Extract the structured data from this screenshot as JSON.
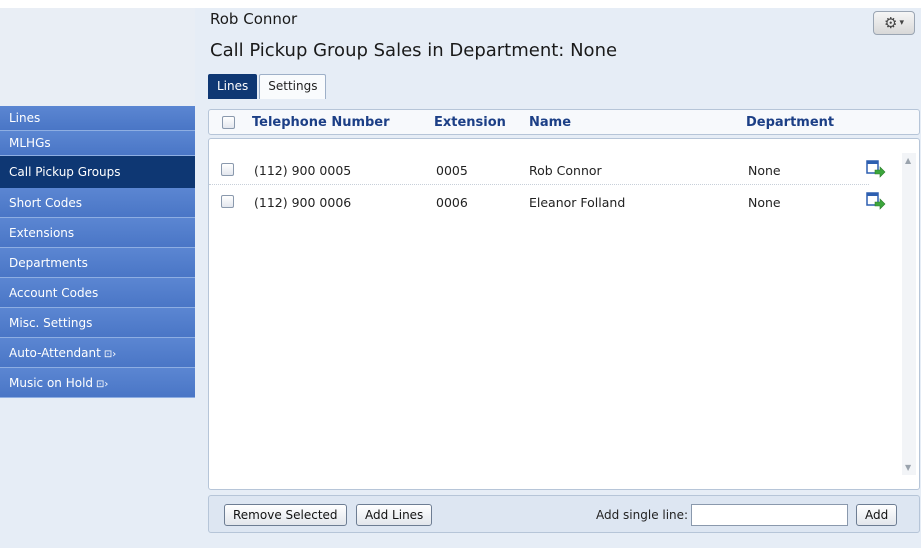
{
  "header": {
    "user_name": "Rob Connor",
    "page_title": "Call Pickup Group Sales in Department: None",
    "gear_icon": "gear-icon"
  },
  "tabs": [
    {
      "label": "Lines",
      "active": true
    },
    {
      "label": "Settings",
      "active": false
    }
  ],
  "sidebar": {
    "items": [
      {
        "label": "Lines",
        "active": false,
        "external": false
      },
      {
        "label": "MLHGs",
        "active": false,
        "external": false
      },
      {
        "label": "Call Pickup Groups",
        "active": true,
        "external": false
      },
      {
        "label": "Short Codes",
        "active": false,
        "external": false
      },
      {
        "label": "Extensions",
        "active": false,
        "external": false
      },
      {
        "label": "Departments",
        "active": false,
        "external": false
      },
      {
        "label": "Account Codes",
        "active": false,
        "external": false
      },
      {
        "label": "Misc. Settings",
        "active": false,
        "external": false
      },
      {
        "label": "Auto-Attendant",
        "active": false,
        "external": true
      },
      {
        "label": "Music on Hold",
        "active": false,
        "external": true
      }
    ],
    "external_glyph": "⊡›"
  },
  "table": {
    "columns": [
      "Telephone Number",
      "Extension",
      "Name",
      "Department"
    ],
    "rows": [
      {
        "telephone": "(112) 900 0005",
        "extension": "0005",
        "name": "Rob Connor",
        "department": "None"
      },
      {
        "telephone": "(112) 900 0006",
        "extension": "0006",
        "name": "Eleanor Folland",
        "department": "None"
      }
    ]
  },
  "footer": {
    "remove_label": "Remove Selected",
    "add_lines_label": "Add Lines",
    "single_line_label": "Add single line:",
    "single_line_value": "",
    "add_label": "Add"
  },
  "colors": {
    "sidebar": "#4a76c6",
    "sidebar_active": "#0e3773",
    "header_text": "#1c3f86",
    "background": "#e6edf6"
  }
}
